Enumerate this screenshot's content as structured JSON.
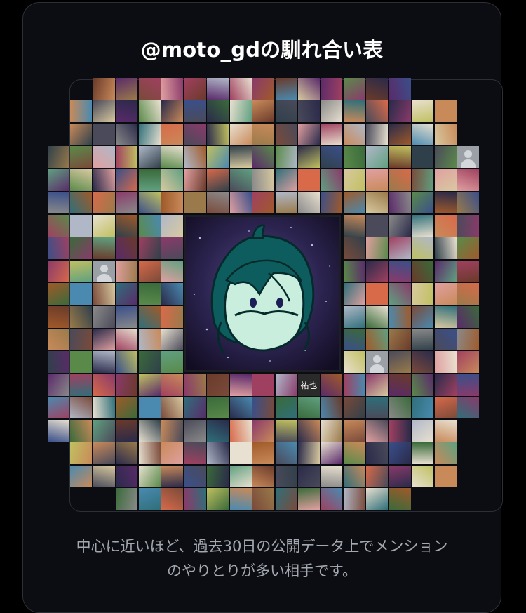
{
  "card": {
    "title": "@moto_gdの馴れ合い表",
    "footer_line1": "中心に近いほど、過去30日の公開データ上でメンション",
    "footer_line2": "のやりとりが多い相手です。"
  },
  "center_avatar": {
    "icon": "green-haired-character-avatar"
  },
  "tile_labels": {
    "named_tile": "祐也"
  },
  "colors": {
    "page_background": "#000000",
    "card_background": "#0c0d12",
    "card_border": "#2d2f36",
    "title_text": "#ffffff",
    "footer_text": "#a3a8b0"
  }
}
